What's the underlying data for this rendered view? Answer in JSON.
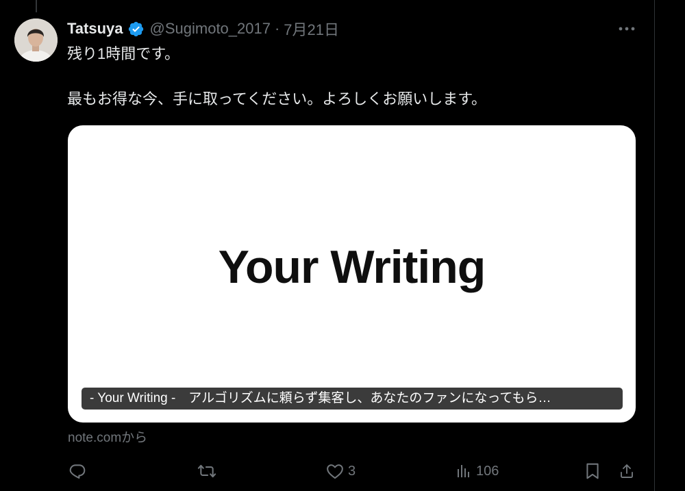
{
  "tweet": {
    "author": {
      "display_name": "Tatsuya",
      "handle": "@Sugimoto_2017",
      "verified": true
    },
    "separator": "·",
    "date": "7月21日",
    "text_lines": [
      "残り1時間です。",
      "最もお得な今、手に取ってください。よろしくお願いします。"
    ],
    "card": {
      "image_text": "Your Writing",
      "caption": "- Your Writing -　アルゴリズムに頼らず集客し、あなたのファンになってもら…",
      "source": "note.comから"
    },
    "actions": {
      "reply_count": "",
      "retweet_count": "",
      "like_count": "3",
      "views_count": "106"
    }
  },
  "icons": {
    "more": "more-dots-icon",
    "verified": "verified-badge-icon",
    "reply": "reply-icon",
    "retweet": "retweet-icon",
    "like": "heart-icon",
    "views": "views-chart-icon",
    "bookmark": "bookmark-icon",
    "share": "share-icon"
  },
  "colors": {
    "background": "#000000",
    "text_primary": "#e7e9ea",
    "text_secondary": "#71767b",
    "verified_blue": "#1d9bf0"
  }
}
